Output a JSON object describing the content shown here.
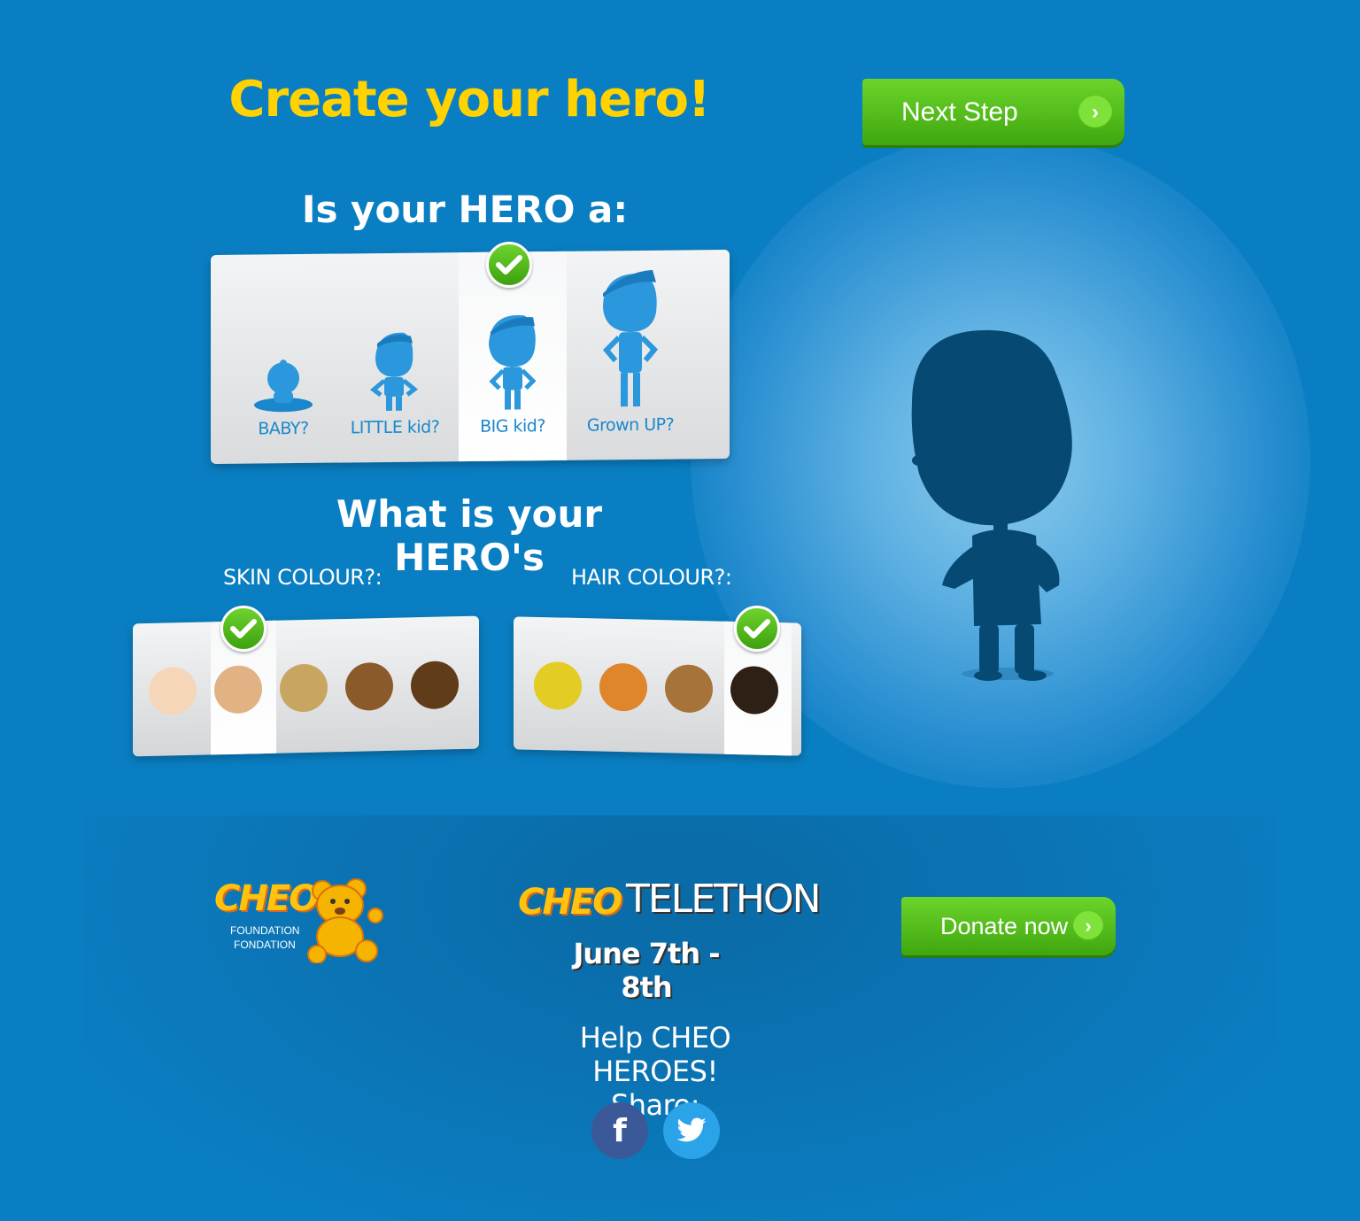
{
  "header": {
    "title": "Create your hero!",
    "next_button": "Next Step"
  },
  "age": {
    "question": "Is your HERO a:",
    "options": [
      {
        "label": "BABY?",
        "selected": false
      },
      {
        "label": "LITTLE kid?",
        "selected": false
      },
      {
        "label": "BIG kid?",
        "selected": true
      },
      {
        "label": "Grown UP?",
        "selected": false
      }
    ]
  },
  "appearance": {
    "question": "What is your HERO's",
    "skin_label": "SKIN COLOUR?:",
    "hair_label": "HAIR COLOUR?:",
    "skin_colours": [
      "#f6d6b8",
      "#e1b384",
      "#c8a662",
      "#8b5a2b",
      "#613c18"
    ],
    "skin_selected_index": 1,
    "hair_colours": [
      "#e3cc23",
      "#e0862a",
      "#a6733a",
      "#2e2014"
    ],
    "hair_selected_index": 3
  },
  "footer": {
    "logo_text": "CHEO",
    "logo_sub1": "FOUNDATION",
    "logo_sub2": "FONDATION",
    "telethon_brand": "CHEO",
    "telethon_word": "TELETHON",
    "telethon_date": "June 7th - 8th",
    "donate_button": "Donate now",
    "help_line1": "Help CHEO HEROES!",
    "help_line2": "Share:"
  },
  "colors": {
    "background": "#0a7ec2",
    "title_yellow": "#ffd200",
    "button_green": "#4cb317",
    "silhouette": "#064a74",
    "facebook": "#3b5998",
    "twitter": "#2aa3e8"
  }
}
